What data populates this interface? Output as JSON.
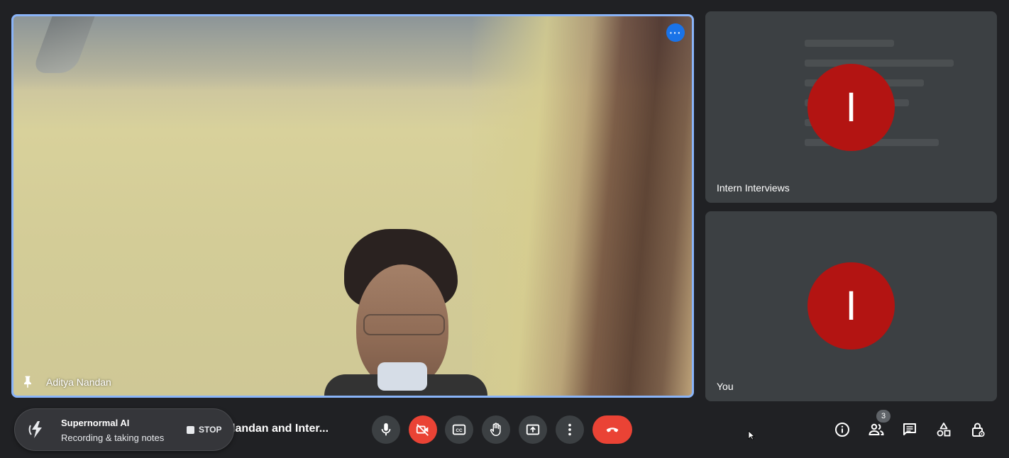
{
  "main_tile": {
    "participant_name": "Aditya Nandan"
  },
  "side_tiles": [
    {
      "participant_name": "Intern Interviews",
      "avatar_initial": "I",
      "avatar_color": "#b31412"
    },
    {
      "participant_name": "You",
      "avatar_initial": "I",
      "avatar_color": "#b31412"
    }
  ],
  "recorder": {
    "title": "Supernormal AI",
    "status": "Recording & taking notes",
    "stop_label": "STOP"
  },
  "meeting": {
    "title": "landan and Inter..."
  },
  "controls": [
    "mic-icon",
    "camera-off-icon",
    "captions-icon",
    "raise-hand-icon",
    "present-screen-icon",
    "more-options-icon",
    "leave-call-icon"
  ],
  "right_controls": {
    "icons": [
      "info-icon",
      "people-icon",
      "chat-icon",
      "activities-icon",
      "host-controls-icon"
    ],
    "participant_count": "3"
  },
  "colors": {
    "background": "#202124",
    "tile": "#3c4043",
    "accent": "#8ab4f8",
    "danger": "#ea4335"
  }
}
